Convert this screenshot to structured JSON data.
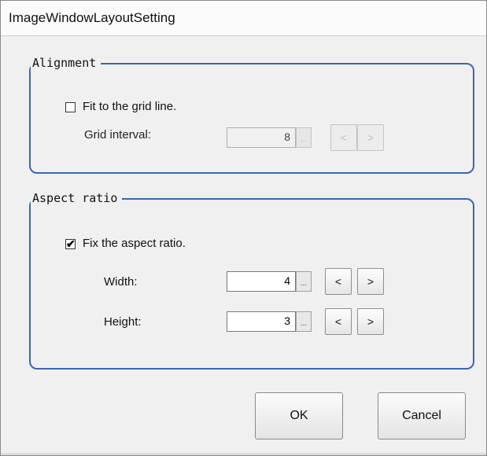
{
  "window": {
    "title": "ImageWindowLayoutSetting"
  },
  "alignment": {
    "legend": "Alignment",
    "fit_grid_label": "Fit to the grid line.",
    "fit_grid_checked": false,
    "grid_interval_label": "Grid interval:",
    "grid_interval_value": "8",
    "ellipsis": "...",
    "decrement": "<",
    "increment": ">"
  },
  "aspect": {
    "legend": "Aspect ratio",
    "fix_label": "Fix the aspect ratio.",
    "fix_checked": true,
    "checkmark": "✔",
    "width_label": "Width:",
    "width_value": "4",
    "height_label": "Height:",
    "height_value": "3",
    "ellipsis": "...",
    "decrement": "<",
    "increment": ">"
  },
  "buttons": {
    "ok": "OK",
    "cancel": "Cancel"
  }
}
